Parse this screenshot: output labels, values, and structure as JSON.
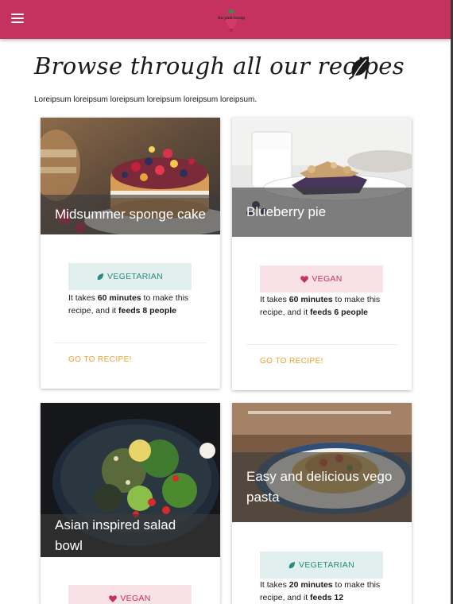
{
  "header": {
    "logo_text": "the pink turnip",
    "brand_color": "#c6325f",
    "menu_icon": "hamburger-menu-icon"
  },
  "page": {
    "title": "Browse through all our recipes",
    "title_icon": "leaf-icon",
    "intro": "Loreipsum loreipsum loreipsum loreipsum loreipsum loreipsum."
  },
  "cards": [
    {
      "title": "Midsummer sponge cake",
      "tag": "VEGETARIAN",
      "tag_icon": "leaf-icon",
      "desc_pre": "It takes ",
      "time": "60 minutes",
      "desc_mid": " to make this recipe, and it ",
      "feeds": "feeds 8 people",
      "link": "GO TO RECIPE!"
    },
    {
      "title": "Blueberry pie",
      "tag": "VEGAN",
      "tag_icon": "heart-icon",
      "desc_pre": "It takes ",
      "time": "60 minutes",
      "desc_mid": " to make this recipe, and it ",
      "feeds": "feeds 6 people",
      "link": "GO TO RECIPE!"
    },
    {
      "title": "Asian inspired salad bowl",
      "tag": "VEGAN",
      "tag_icon": "heart-icon"
    },
    {
      "title": "Easy and delicious vego pasta",
      "tag": "VEGETARIAN",
      "tag_icon": "leaf-icon",
      "desc_pre": "It takes ",
      "time": "20 minutes",
      "desc_mid": " to make this recipe, and it ",
      "feeds": "feeds 12"
    }
  ],
  "colors": {
    "vegetarian_tag_bg": "#e1f0ef",
    "vegetarian_tag_text": "#2a8a7f",
    "vegan_tag_bg": "#f9e1e8",
    "vegan_tag_text": "#c6325f",
    "link": "#f0a030"
  }
}
